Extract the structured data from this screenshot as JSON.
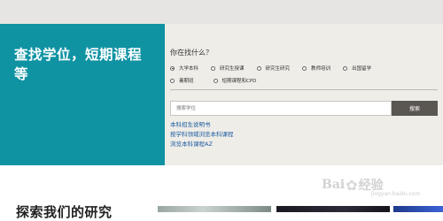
{
  "hero": {
    "title": "查找学位，短期课程等",
    "question": "你在找什么？",
    "options_row1": [
      {
        "label": "大学本科",
        "selected": true
      },
      {
        "label": "研究生授课",
        "selected": false
      },
      {
        "label": "研究生研究",
        "selected": false
      },
      {
        "label": "教师培训",
        "selected": false
      },
      {
        "label": "出国留学",
        "selected": false
      }
    ],
    "options_row2": [
      {
        "label": "暑期班",
        "selected": false
      },
      {
        "label": "短期课程和CPD",
        "selected": false
      }
    ],
    "search": {
      "placeholder": "搜索学位",
      "button_label": "搜索"
    },
    "links": [
      "本科招生说明书",
      "按学科领域浏览本科课程",
      "浏览本科课程AZ"
    ]
  },
  "bottom": {
    "heading": "探索我们的研究"
  },
  "watermark": {
    "text": "Bai",
    "text2": "经验",
    "sub": "jingyan.baidu.com"
  },
  "colors": {
    "teal": "#0f93a3",
    "button": "#5a5652",
    "link": "#1a5aa0"
  }
}
